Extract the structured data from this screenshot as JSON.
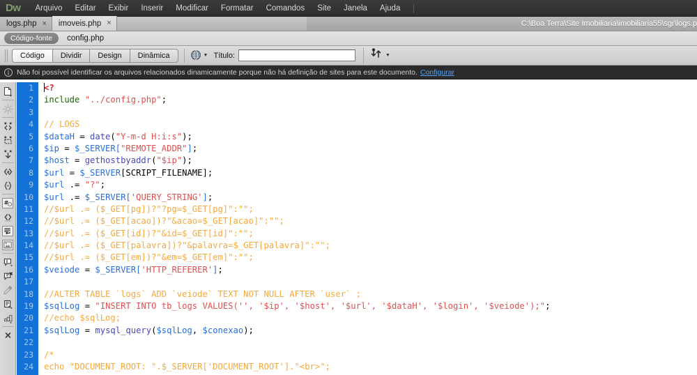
{
  "app": {
    "logo": "Dw",
    "menus": [
      "Arquivo",
      "Editar",
      "Exibir",
      "Inserir",
      "Modificar",
      "Formatar",
      "Comandos",
      "Site",
      "Janela",
      "Ajuda"
    ]
  },
  "tabs": [
    {
      "label": "logs.php",
      "close": "×",
      "active": false
    },
    {
      "label": "imoveis.php",
      "close": "×",
      "active": true
    }
  ],
  "path_bar": {
    "path": "C:\\Boa Terra\\Site Imobiliaria\\imobiliaria55\\sgr\\logs.p"
  },
  "source_strip": {
    "pill": "Código-fonte",
    "file": "config.php"
  },
  "view_toolbar": {
    "buttons": [
      {
        "label": "Código",
        "selected": true
      },
      {
        "label": "Dividir",
        "selected": false
      },
      {
        "label": "Design",
        "selected": false
      },
      {
        "label": "Dinâmica",
        "selected": false
      }
    ],
    "title_label": "Título:",
    "title_value": "",
    "title_placeholder": ""
  },
  "info_bar": {
    "icon": "i",
    "message": "Não foi possível identificar os arquivos relacionados dinamicamente porque não há definição de sites para este documento.",
    "link": "Configurar"
  },
  "coding_toolbar": {
    "icons": [
      "open-documents-icon",
      "highlight-invalid-code-icon",
      "collapse-full-tag-icon",
      "collapse-selection-icon",
      "expand-all-icon",
      "select-parent-tag-icon",
      "balance-braces-icon",
      "line-numbers-icon",
      "recent-snippets-icon",
      "wrap-tag-icon",
      "apply-comment-icon",
      "remove-comment-icon",
      "indent-code-icon",
      "outdent-code-icon",
      "format-source-code-icon",
      "more-options-icon"
    ]
  },
  "editor": {
    "first_visible_line": 1,
    "caret_line": 1,
    "lines": [
      {
        "no": "1",
        "tokens": [
          {
            "c": "caret",
            "t": ""
          },
          {
            "c": "t-php",
            "t": "<?"
          }
        ]
      },
      {
        "no": "2",
        "tokens": [
          {
            "c": "t-kw",
            "t": "include "
          },
          {
            "c": "t-str",
            "t": "\"../config.php\""
          },
          {
            "c": "t-plain",
            "t": ";"
          }
        ]
      },
      {
        "no": "3",
        "tokens": []
      },
      {
        "no": "4",
        "tokens": [
          {
            "c": "t-cmt",
            "t": "// LOGS"
          }
        ]
      },
      {
        "no": "5",
        "tokens": [
          {
            "c": "t-var",
            "t": "$dataH"
          },
          {
            "c": "t-plain",
            "t": " = "
          },
          {
            "c": "t-fn",
            "t": "date"
          },
          {
            "c": "t-plain",
            "t": "("
          },
          {
            "c": "t-str",
            "t": "\"Y-m-d H:i:s\""
          },
          {
            "c": "t-plain",
            "t": ");"
          }
        ]
      },
      {
        "no": "6",
        "tokens": [
          {
            "c": "t-var",
            "t": "$ip"
          },
          {
            "c": "t-plain",
            "t": " = "
          },
          {
            "c": "t-var",
            "t": "$_SERVER"
          },
          {
            "c": "t-blue",
            "t": "["
          },
          {
            "c": "t-str",
            "t": "\"REMOTE_ADDR\""
          },
          {
            "c": "t-blue",
            "t": "]"
          },
          {
            "c": "t-plain",
            "t": ";"
          }
        ]
      },
      {
        "no": "7",
        "tokens": [
          {
            "c": "t-var",
            "t": "$host"
          },
          {
            "c": "t-plain",
            "t": " = "
          },
          {
            "c": "t-fn",
            "t": "gethostbyaddr"
          },
          {
            "c": "t-plain",
            "t": "("
          },
          {
            "c": "t-str",
            "t": "\"$ip\""
          },
          {
            "c": "t-plain",
            "t": ");"
          }
        ]
      },
      {
        "no": "8",
        "tokens": [
          {
            "c": "t-var",
            "t": "$url"
          },
          {
            "c": "t-plain",
            "t": " = "
          },
          {
            "c": "t-var",
            "t": "$_SERVER"
          },
          {
            "c": "t-plain",
            "t": "[SCRIPT_FILENAME];"
          }
        ]
      },
      {
        "no": "9",
        "tokens": [
          {
            "c": "t-var",
            "t": "$url"
          },
          {
            "c": "t-plain",
            "t": " .= "
          },
          {
            "c": "t-str",
            "t": "\"?\""
          },
          {
            "c": "t-plain",
            "t": ";"
          }
        ]
      },
      {
        "no": "10",
        "tokens": [
          {
            "c": "t-var",
            "t": "$url"
          },
          {
            "c": "t-plain",
            "t": " .= "
          },
          {
            "c": "t-var",
            "t": "$_SERVER"
          },
          {
            "c": "t-blue",
            "t": "["
          },
          {
            "c": "t-str",
            "t": "'QUERY_STRING'"
          },
          {
            "c": "t-blue",
            "t": "]"
          },
          {
            "c": "t-plain",
            "t": ";"
          }
        ]
      },
      {
        "no": "11",
        "tokens": [
          {
            "c": "t-cmt",
            "t": "//$url .= ($_GET[pg])?\"?pg=$_GET[pg]\":\"\";"
          }
        ]
      },
      {
        "no": "12",
        "tokens": [
          {
            "c": "t-cmt",
            "t": "//$url .= ($_GET[acao])?\"&acao=$_GET[acao]\":\"\";"
          }
        ]
      },
      {
        "no": "13",
        "tokens": [
          {
            "c": "t-cmt",
            "t": "//$url .= ($_GET[id])?\"&id=$_GET[id]\":\"\";"
          }
        ]
      },
      {
        "no": "14",
        "tokens": [
          {
            "c": "t-cmt",
            "t": "//$url .= ($_GET[palavra])?\"&palavra=$_GET[palavra]\":\"\";"
          }
        ]
      },
      {
        "no": "15",
        "tokens": [
          {
            "c": "t-cmt",
            "t": "//$url .= ($_GET[em])?\"&em=$_GET[em]\":\"\";"
          }
        ]
      },
      {
        "no": "16",
        "tokens": [
          {
            "c": "t-var",
            "t": "$veiode"
          },
          {
            "c": "t-plain",
            "t": " = "
          },
          {
            "c": "t-var",
            "t": "$_SERVER"
          },
          {
            "c": "t-blue",
            "t": "["
          },
          {
            "c": "t-str",
            "t": "'HTTP_REFERER'"
          },
          {
            "c": "t-blue",
            "t": "]"
          },
          {
            "c": "t-plain",
            "t": ";"
          }
        ]
      },
      {
        "no": "17",
        "tokens": []
      },
      {
        "no": "18",
        "tokens": [
          {
            "c": "t-cmt",
            "t": "//ALTER TABLE `logs` ADD `veiode` TEXT NOT NULL AFTER `user` ;"
          }
        ]
      },
      {
        "no": "19",
        "tokens": [
          {
            "c": "t-var",
            "t": "$sqlLog"
          },
          {
            "c": "t-plain",
            "t": " = "
          },
          {
            "c": "t-str",
            "t": "\"INSERT INTO tb_logs VALUES('', '$ip', '$host', '$url', '$dataH', '$login', '$veiode');\""
          },
          {
            "c": "t-plain",
            "t": ";"
          }
        ]
      },
      {
        "no": "20",
        "tokens": [
          {
            "c": "t-cmt",
            "t": "//echo $sqlLog;"
          }
        ]
      },
      {
        "no": "21",
        "tokens": [
          {
            "c": "t-var",
            "t": "$sqlLog"
          },
          {
            "c": "t-plain",
            "t": " = "
          },
          {
            "c": "t-fn",
            "t": "mysql_query"
          },
          {
            "c": "t-plain",
            "t": "("
          },
          {
            "c": "t-var",
            "t": "$sqlLog"
          },
          {
            "c": "t-plain",
            "t": ", "
          },
          {
            "c": "t-var",
            "t": "$conexao"
          },
          {
            "c": "t-plain",
            "t": ");"
          }
        ]
      },
      {
        "no": "22",
        "tokens": []
      },
      {
        "no": "23",
        "tokens": [
          {
            "c": "t-cmt",
            "t": "/*"
          }
        ]
      },
      {
        "no": "24",
        "tokens": [
          {
            "c": "t-cmt",
            "t": "echo \"DOCUMENT_ROOT: \".$_SERVER['DOCUMENT_ROOT'].\"<br>\";"
          }
        ]
      }
    ]
  },
  "colors": {
    "gutter": "#1371d8",
    "gutter_text": "#9fcaf4",
    "menubar": "#2e2e2e",
    "logo": "#7f9c6f",
    "comment": "#f5a83c",
    "string": "#e05050",
    "variable": "#2a6fd8",
    "function": "#4a4ab8",
    "keyword": "#1c6600",
    "php_tag": "#d82020",
    "link": "#4da2ff"
  }
}
